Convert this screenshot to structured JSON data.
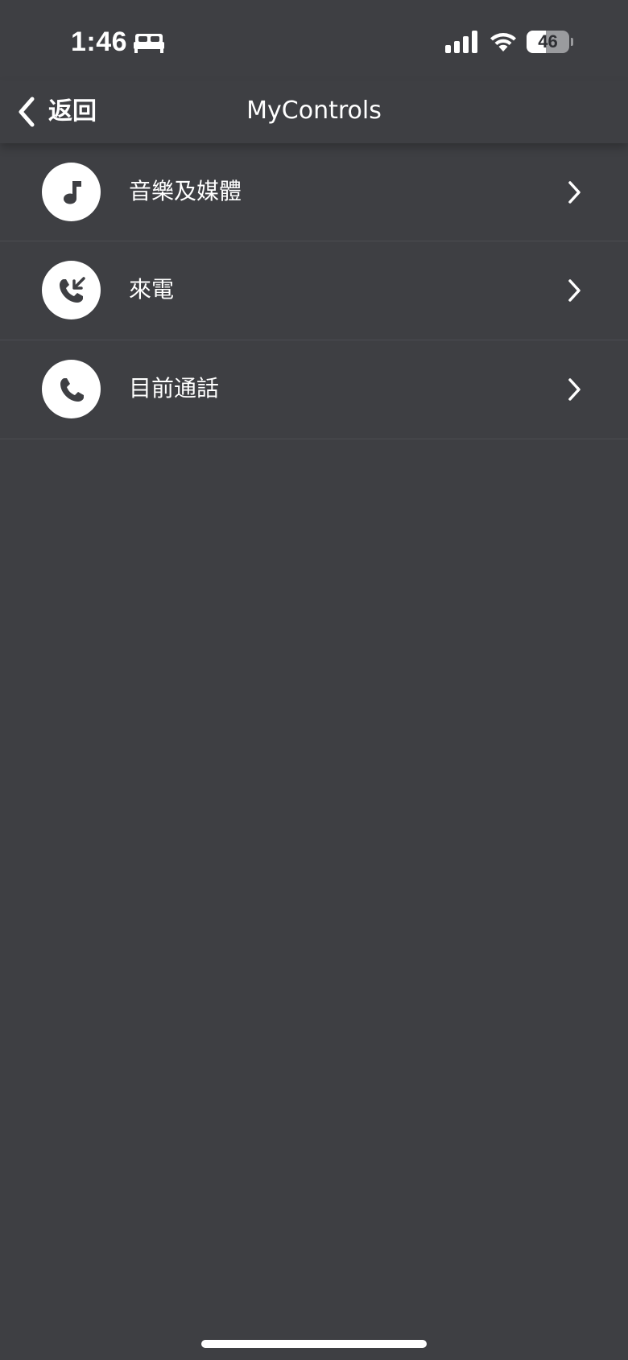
{
  "status_bar": {
    "time": "1:46",
    "focus_icon": "bed-icon",
    "signal_icon": "cellular-signal-icon",
    "wifi_icon": "wifi-icon",
    "battery_level": "46",
    "battery_fraction": 0.46
  },
  "nav": {
    "back_label": "返回",
    "title": "MyControls"
  },
  "list": {
    "items": [
      {
        "label": "音樂及媒體",
        "icon": "music-note-icon"
      },
      {
        "label": "來電",
        "icon": "incoming-call-icon"
      },
      {
        "label": "目前通話",
        "icon": "phone-icon"
      }
    ]
  },
  "colors": {
    "background": "#3e3f43",
    "divider": "#4c4d52",
    "foreground": "#ffffff"
  }
}
